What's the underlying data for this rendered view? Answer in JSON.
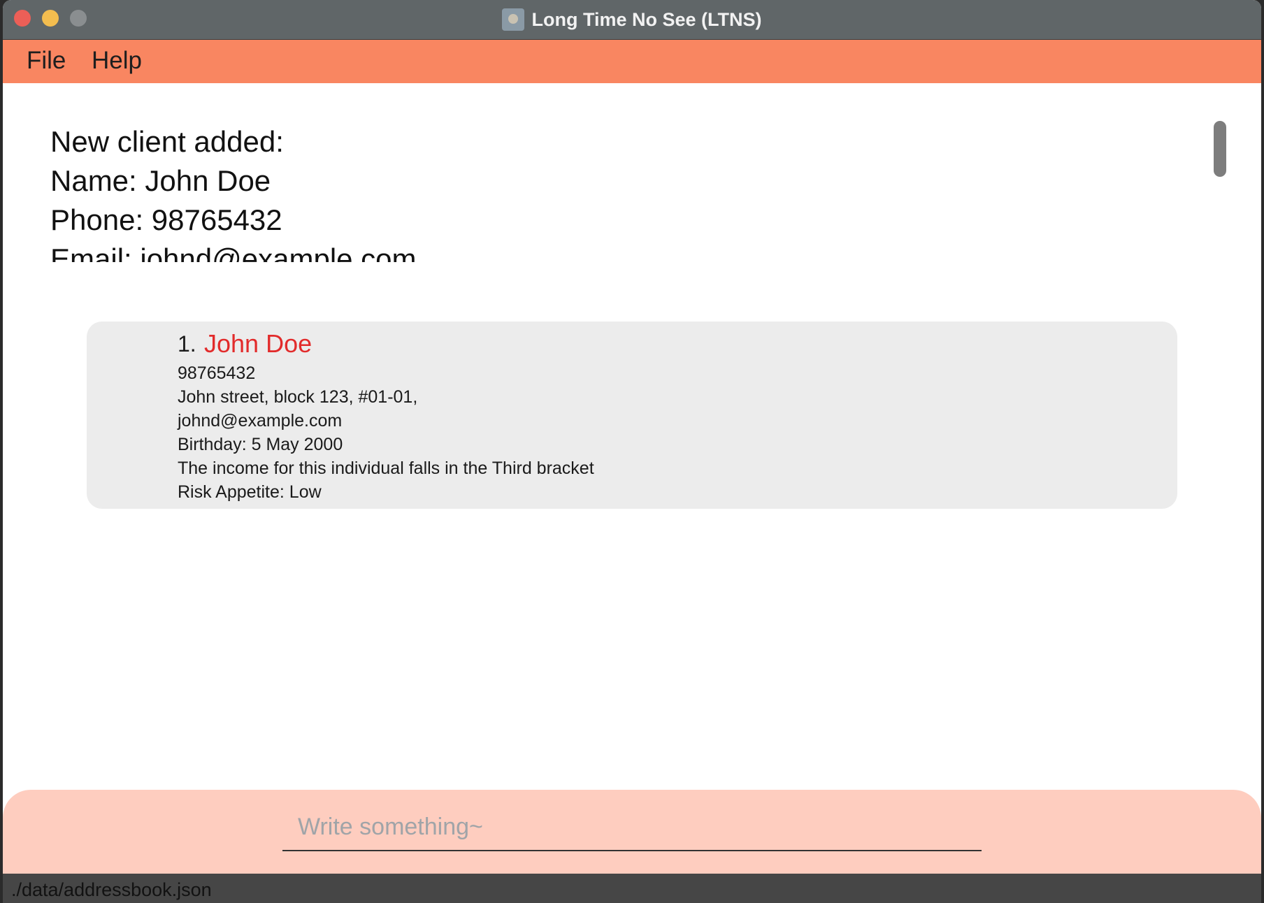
{
  "window": {
    "title": "Long Time No See (LTNS)"
  },
  "menu": {
    "items": [
      "File",
      "Help"
    ]
  },
  "result": {
    "lines": [
      "New client added:",
      "Name: John Doe",
      "Phone: 98765432",
      "Email: johnd@example.com"
    ]
  },
  "clients": [
    {
      "index": "1.",
      "name": "John Doe",
      "phone": "98765432",
      "address": "John street, block 123, #01-01,",
      "email": "johnd@example.com",
      "birthday": "Birthday: 5 May 2000",
      "income": "The income for this individual falls in the Third bracket",
      "risk": "Risk Appetite: Low"
    }
  ],
  "command": {
    "placeholder": "Write something~",
    "value": ""
  },
  "status": {
    "path": "./data/addressbook.json"
  },
  "colors": {
    "titlebar": "#606668",
    "menubar": "#f98661",
    "command_box": "#fecdbf",
    "client_name": "#e22b2b",
    "card_bg": "#ececec",
    "statusbar": "#464646"
  }
}
